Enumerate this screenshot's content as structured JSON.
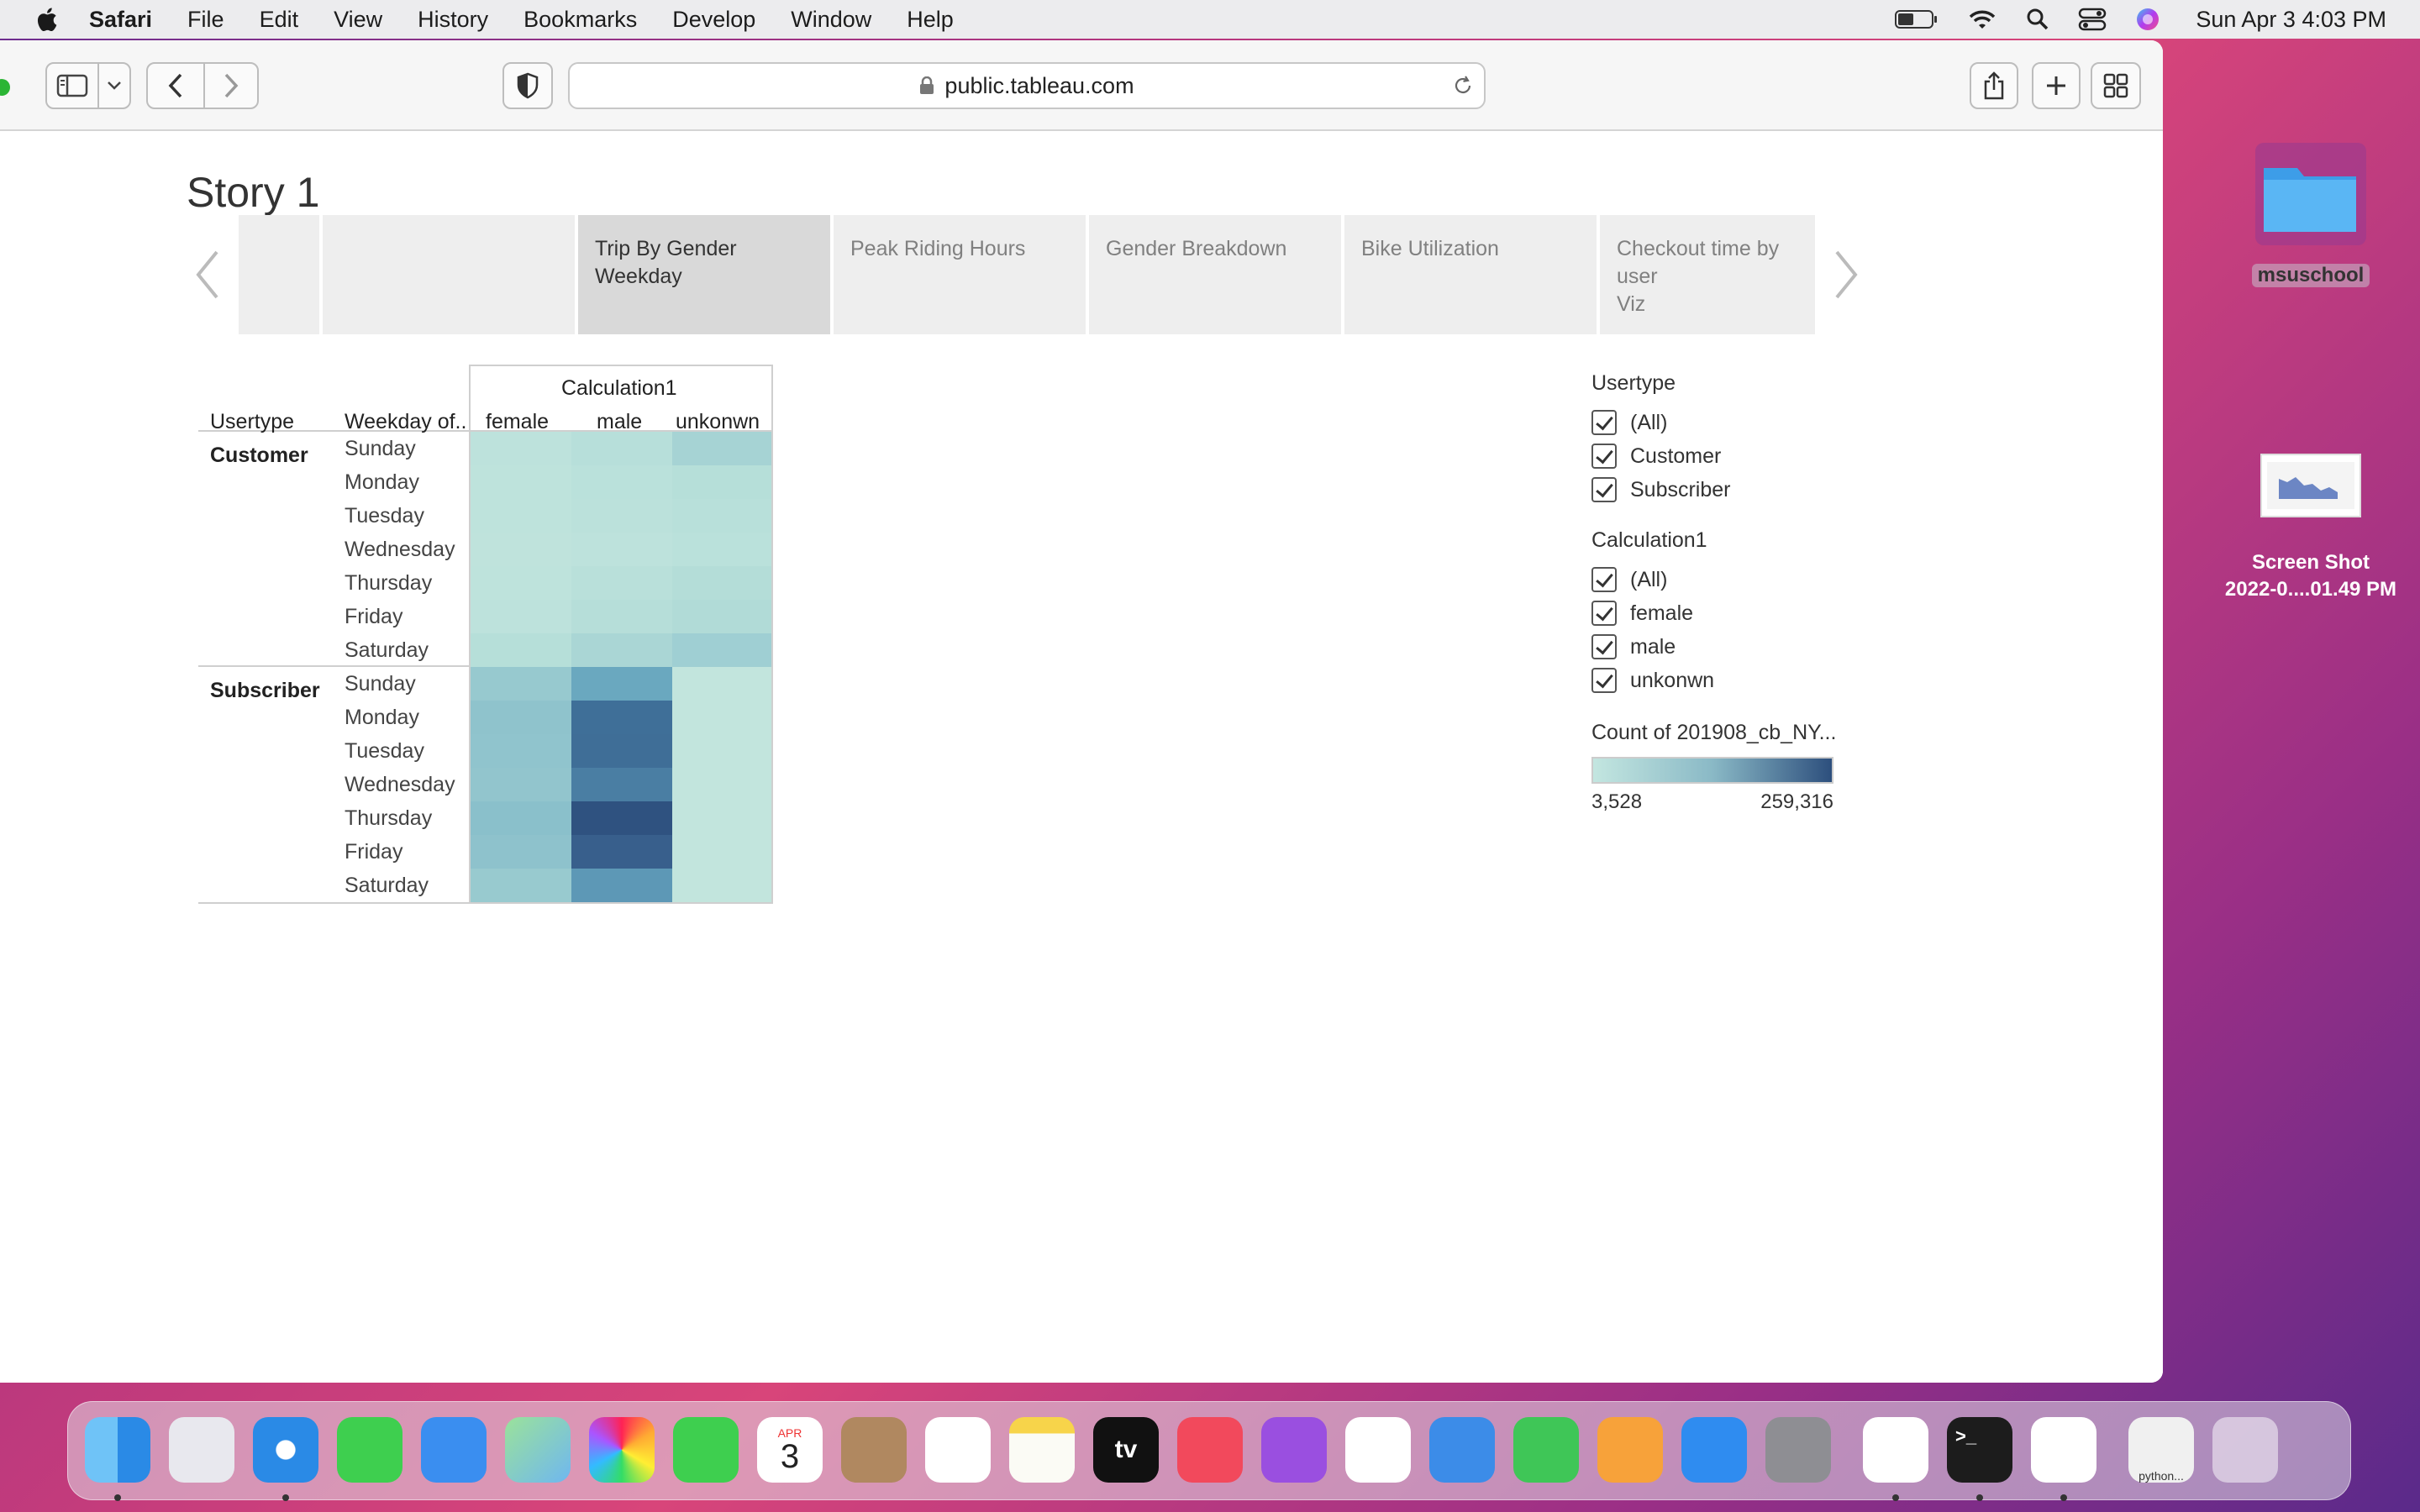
{
  "menubar": {
    "app": "Safari",
    "items": [
      "File",
      "Edit",
      "View",
      "History",
      "Bookmarks",
      "Develop",
      "Window",
      "Help"
    ],
    "clock": "Sun Apr 3  4:03 PM"
  },
  "browser": {
    "url": "public.tableau.com"
  },
  "story": {
    "title": "Story 1",
    "tabs": [
      {
        "label": ""
      },
      {
        "label": ""
      },
      {
        "label": "Trip By Gender\nWeekday"
      },
      {
        "label": "Peak Riding Hours"
      },
      {
        "label": "Gender Breakdown"
      },
      {
        "label": "Bike Utilization"
      },
      {
        "label": "Checkout time by user\nViz"
      }
    ]
  },
  "viz": {
    "col_group_header": "Calculation1",
    "row_headers": [
      "Usertype",
      "Weekday of.."
    ],
    "columns": [
      "female",
      "male",
      "unkonwn"
    ],
    "usertypes": [
      "Customer",
      "Subscriber"
    ],
    "weekdays": [
      "Sunday",
      "Monday",
      "Tuesday",
      "Wednesday",
      "Thursday",
      "Friday",
      "Saturday"
    ],
    "heat_colors": {
      "Customer": [
        [
          "#bde2dc",
          "#b7dfda",
          "#a6d3d4"
        ],
        [
          "#bee3dc",
          "#bae1db",
          "#b6dfd9"
        ],
        [
          "#bee3dc",
          "#bbe1db",
          "#b8e0da"
        ],
        [
          "#bfe3dc",
          "#bde2dc",
          "#bae1db"
        ],
        [
          "#bee3dc",
          "#b9e0da",
          "#b4ddd8"
        ],
        [
          "#bde2dc",
          "#b6ded9",
          "#b1dbd7"
        ],
        [
          "#b6dfd9",
          "#aad6d5",
          "#9fcfd3"
        ]
      ],
      "Subscriber": [
        [
          "#97c9cf",
          "#6aa8bf",
          "#c2e5dd"
        ],
        [
          "#8fc3cc",
          "#3f6f98",
          "#c2e5dd"
        ],
        [
          "#90c4cd",
          "#3f6e97",
          "#c2e5dd"
        ],
        [
          "#92c5cd",
          "#4a7ea3",
          "#c2e5dd"
        ],
        [
          "#8ac0cb",
          "#2f5280",
          "#c2e5dd"
        ],
        [
          "#8ec2cc",
          "#385f8c",
          "#c2e5dd"
        ],
        [
          "#98cacf",
          "#5d98b6",
          "#c2e5dd"
        ]
      ]
    }
  },
  "filters": {
    "usertype": {
      "title": "Usertype",
      "options": [
        "(All)",
        "Customer",
        "Subscriber"
      ]
    },
    "calc": {
      "title": "Calculation1",
      "options": [
        "(All)",
        "female",
        "male",
        "unkonwn"
      ]
    },
    "color_legend": {
      "title": "Count of 201908_cb_NY...",
      "min": "3,528",
      "max": "259,316"
    }
  },
  "desktop": {
    "folder": "msuschool",
    "screenshot_line1": "Screen Shot",
    "screenshot_line2": "2022-0....01.49 PM"
  },
  "dock": {
    "apps": [
      "finder-icon",
      "launchpad-icon",
      "safari-icon",
      "messages-icon",
      "mail-icon",
      "maps-icon",
      "photos-icon",
      "facetime-icon",
      "calendar-icon",
      "contacts-icon",
      "reminders-icon",
      "notes-icon",
      "tv-icon",
      "music-icon",
      "podcasts-icon",
      "news-icon",
      "keynote-icon",
      "numbers-icon",
      "pages-icon",
      "appstore-icon",
      "system-preferences-icon",
      "vscode-icon",
      "terminal-icon",
      "slack-icon",
      "python-window-icon",
      "trash-icon"
    ],
    "calendar_month": "APR",
    "calendar_day": "3",
    "tv_label": "tv",
    "python_label": "python..."
  }
}
